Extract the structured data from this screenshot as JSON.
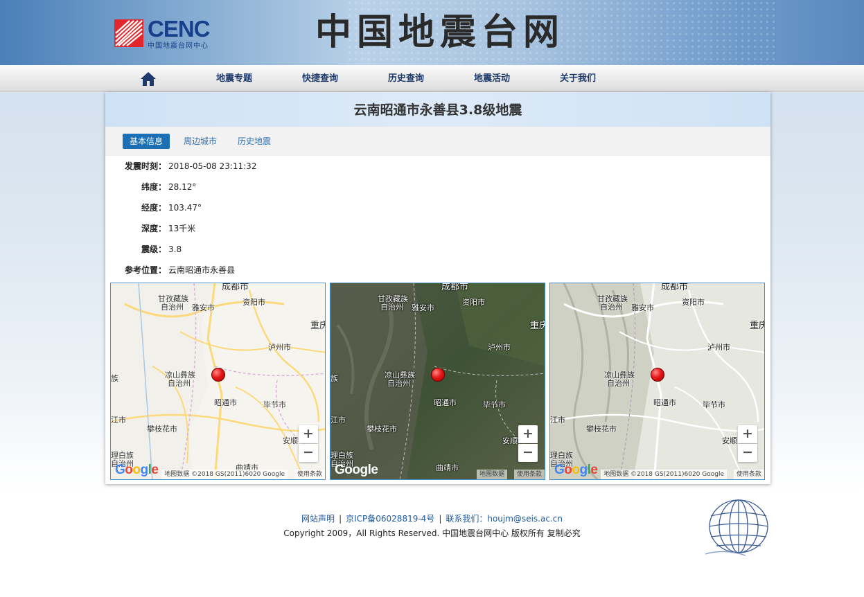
{
  "header": {
    "logo_text": "CENC",
    "logo_sub": "中国地震台网中心",
    "site_title": "中国地震台网"
  },
  "nav": {
    "home_icon": "home-icon",
    "items": [
      "地震专题",
      "快捷查询",
      "历史查询",
      "地震活动",
      "关于我们"
    ]
  },
  "panel": {
    "title": "云南昭通市永善县3.8级地震",
    "tabs": [
      "基本信息",
      "周边城市",
      "历史地震"
    ],
    "active_tab": "基本信息"
  },
  "info": [
    {
      "label": "发震时刻：",
      "value": "2018-05-08 23:11:32"
    },
    {
      "label": "纬度：",
      "value": "28.12°"
    },
    {
      "label": "经度：",
      "value": "103.47°"
    },
    {
      "label": "深度：",
      "value": "13千米"
    },
    {
      "label": "震级：",
      "value": "3.8"
    },
    {
      "label": "参考位置：",
      "value": "云南昭通市永善县"
    }
  ],
  "map": {
    "labels": {
      "chengdu": "成都市",
      "ganzi": "甘孜藏族",
      "ganzi2": "自治州",
      "yaan": "雅安市",
      "ziyang": "资阳市",
      "chongqing": "重庆",
      "luzhou": "泸州市",
      "liangshan": "凉山彝族",
      "liangshan2": "自治州",
      "zhaotong": "昭通市",
      "bijie": "毕节市",
      "lijiang": "江市",
      "panzhihua": "攀枝花市",
      "anshun": "安顺",
      "dali": "理白族",
      "dali2": "自治州",
      "qujing": "曲靖市",
      "edge_zu": "族"
    },
    "zoom_in": "+",
    "zoom_out": "−",
    "google_logo": "Google",
    "attribution": "地图数据 ©2018 GS(2011)6020 Google",
    "attribution_short": "地图数据",
    "terms": "使用条款"
  },
  "footer": {
    "statement": "网站声明",
    "icp": "京ICP备06028819-4号",
    "contact": "联系我们：houjm@seis.ac.cn",
    "copyright": "Copyright 2009，All Rights Reserved. 中国地震台网中心 版权所有 复制必究",
    "globe_icon": "globe-icon"
  }
}
